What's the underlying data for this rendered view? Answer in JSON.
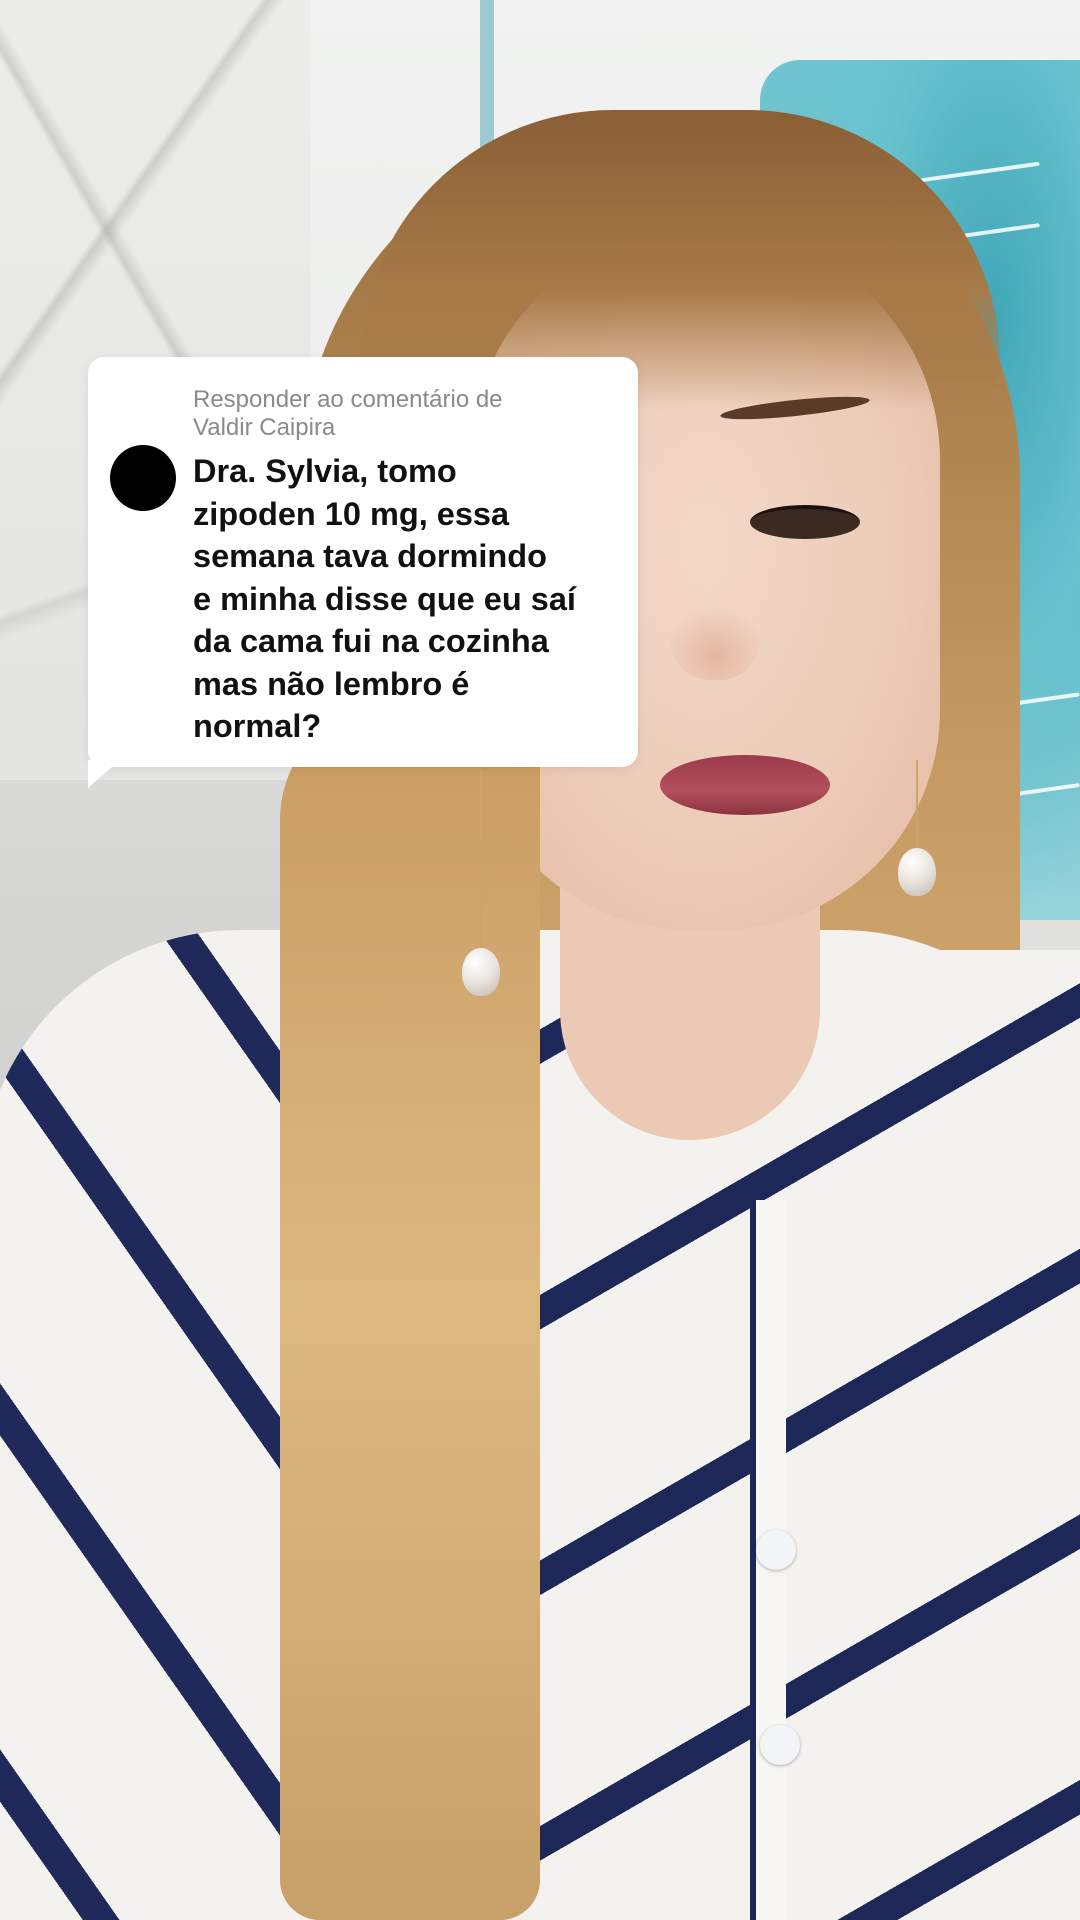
{
  "reply_sticker": {
    "reply_to_label": "Responder ao comentário de\nValdir Caipira",
    "comment_text": "Dra. Sylvia, tomo\nzipoden 10 mg, essa\nsemana tava dormindo\ne minha disse que eu saí\nda cama fui na cozinha\nmas não lembro é\nnormal?",
    "avatar_color": "#000000",
    "card_color": "#ffffff"
  },
  "colors": {
    "shirt_stripe": "#1f2a5a",
    "shirt_base": "#f4f2ee",
    "wall_art": "#5bbfcc",
    "lips": "#9b3c4a"
  }
}
